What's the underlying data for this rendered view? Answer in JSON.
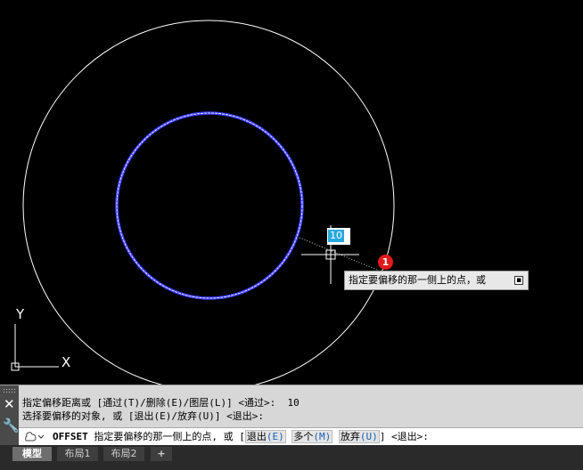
{
  "drawing": {
    "ucs_x_label": "X",
    "ucs_y_label": "Y",
    "dynamic_input_value": "10",
    "marker_number": "1",
    "tooltip_text": "指定要偏移的那一侧上的点，或",
    "tooltip_button_glyph": "▪"
  },
  "command": {
    "close_glyph": "✕",
    "settings_glyph": "🔧",
    "history": [
      "指定偏移距离或 [通过(T)/删除(E)/图层(L)] <通过>:  10",
      "选择要偏移的对象, 或 [退出(E)/放弃(U)] <退出>:"
    ],
    "command_name": "OFFSET",
    "prompt_text": "指定要偏移的那一侧上的点, 或 [",
    "options": [
      {
        "label": "退出",
        "key": "(E)"
      },
      {
        "label": "多个",
        "key": "(M)"
      },
      {
        "label": "放弃",
        "key": "(U)"
      }
    ],
    "prompt_tail": "] <退出>:"
  },
  "tabs": {
    "model": "模型",
    "layout1": "布局1",
    "layout2": "布局2",
    "add": "+"
  },
  "colors": {
    "canvas_bg": "#000000",
    "outer_circle": "#ffffff",
    "inner_circle_glow": "#3a3aff",
    "dynamic_input_highlight": "#2aa8e0",
    "marker": "#e11b1b"
  }
}
